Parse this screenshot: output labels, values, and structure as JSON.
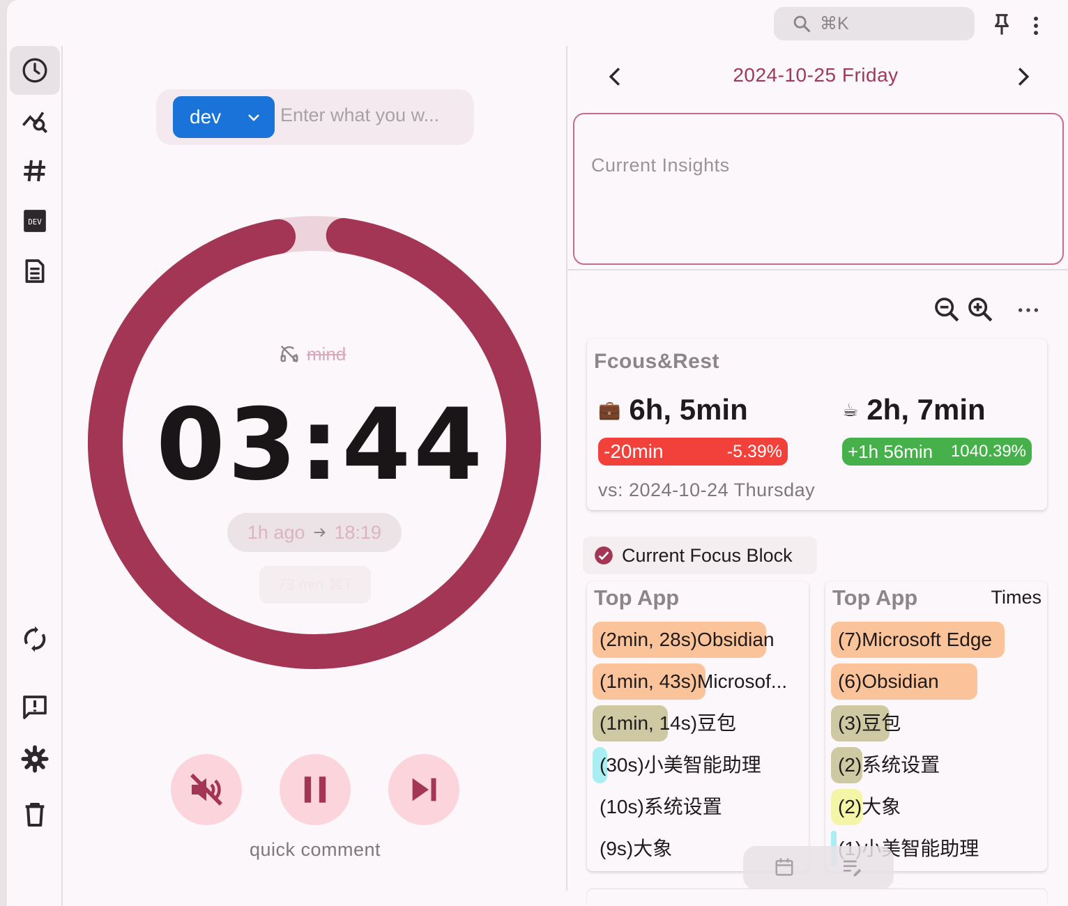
{
  "search": {
    "shortcut": "⌘K"
  },
  "sidebar": {
    "items": [
      {
        "icon": "clock-icon",
        "active": true
      },
      {
        "icon": "analytics-icon"
      },
      {
        "icon": "hashtag-icon"
      },
      {
        "icon": "dev-icon",
        "label": "DEV"
      },
      {
        "icon": "document-icon"
      },
      {
        "icon": "sync-icon"
      },
      {
        "icon": "feedback-icon"
      },
      {
        "icon": "gear-icon"
      },
      {
        "icon": "trash-icon"
      }
    ]
  },
  "timer": {
    "tag": "dev",
    "task_placeholder": "Enter what you w...",
    "mind_label": "mind",
    "time": "03:44",
    "ago": "1h ago",
    "end_time": "18:19",
    "ghost_chip": "73 min ⌘T",
    "progress_fraction": 0.95,
    "quick_comment": "quick comment",
    "ring_color": "#a33654",
    "ring_track_color": "#ecd3dc"
  },
  "panel": {
    "date": "2024-10-25 Friday",
    "insights_placeholder": "Current Insights",
    "focus_rest": {
      "title": "Fcous&Rest",
      "focus_icon": "💼",
      "focus_value": "6h, 5min",
      "focus_delta": "-20min",
      "focus_delta_pct": "-5.39%",
      "rest_icon": "☕",
      "rest_value": "2h, 7min",
      "rest_delta": "+1h 56min",
      "rest_delta_pct": "1040.39%",
      "compare": "vs: 2024-10-24 Thursday"
    },
    "focus_block_label": "Current Focus Block",
    "top_app_title": "Top App",
    "times_label": "Times",
    "top_apps_duration": [
      {
        "label": "(2min, 28s)Obsidian",
        "bar_fraction": 0.83,
        "color": "#fbc39a"
      },
      {
        "label": "(1min, 43s)Microsof...",
        "bar_fraction": 0.54,
        "color": "#fbc39a"
      },
      {
        "label": "(1min, 14s)豆包",
        "bar_fraction": 0.36,
        "color": "#cfc9a3"
      },
      {
        "label": "(30s)小美智能助理",
        "bar_fraction": 0.07,
        "color": "#a8eef2"
      },
      {
        "label": "(10s)系统设置",
        "bar_fraction": 0.0,
        "color": "#cfc9a3"
      },
      {
        "label": "(9s)大象",
        "bar_fraction": 0.0,
        "color": "#f4f5a6"
      }
    ],
    "top_apps_count": [
      {
        "label": "(7)Microsoft Edge",
        "bar_fraction": 0.83,
        "color": "#fbc39a"
      },
      {
        "label": "(6)Obsidian",
        "bar_fraction": 0.7,
        "color": "#fbc39a"
      },
      {
        "label": "(3)豆包",
        "bar_fraction": 0.28,
        "color": "#cfc9a3"
      },
      {
        "label": "(2)系统设置",
        "bar_fraction": 0.15,
        "color": "#cfc9a3"
      },
      {
        "label": "(2)大象",
        "bar_fraction": 0.15,
        "color": "#f4f5a6"
      },
      {
        "label": "(1)小美智能助理",
        "bar_fraction": 0.01,
        "color": "#a8eef2"
      }
    ]
  }
}
